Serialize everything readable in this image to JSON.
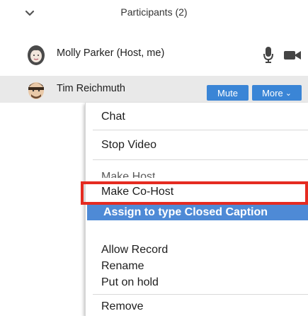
{
  "header": {
    "title": "Participants (2)"
  },
  "participants": [
    {
      "name": "Molly Parker (Host, me)",
      "avatar_icon": "participant-avatar-woman"
    },
    {
      "name": "Tim Reichmuth",
      "avatar_icon": "participant-avatar-man",
      "mute_label": "Mute",
      "more_label": "More"
    }
  ],
  "menu": {
    "items": {
      "chat": "Chat",
      "stop_video": "Stop Video",
      "make_host": "Make Host",
      "make_co_host": "Make Co-Host",
      "assign_caption": "Assign to type Closed Caption",
      "allow_record": "Allow Record",
      "rename": "Rename",
      "put_on_hold": "Put on hold",
      "remove": "Remove"
    }
  },
  "colors": {
    "button_blue": "#3a85d6",
    "selected_row": "#4e8ad6",
    "highlight_red": "#e52b21",
    "row_gray": "#e9e9e9"
  }
}
